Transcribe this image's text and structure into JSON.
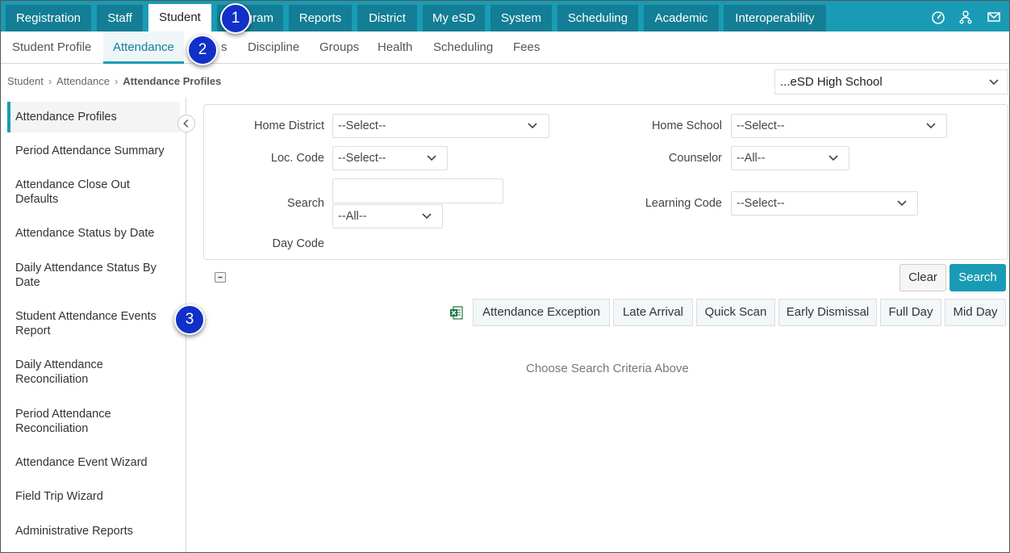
{
  "topnav": {
    "tabs": [
      "Registration",
      "Staff",
      "Student",
      "gram",
      "Reports",
      "District",
      "My eSD",
      "System",
      "Scheduling",
      "Academic",
      "Interoperability"
    ],
    "icons": [
      "dashboard-icon",
      "user-network-icon",
      "mail-icon"
    ]
  },
  "subnav": {
    "tabs": [
      "Student Profile",
      "Attendance",
      "s",
      "Discipline",
      "Groups",
      "Health",
      "Scheduling",
      "Fees"
    ]
  },
  "breadcrumb": {
    "items": [
      "Student",
      "Attendance",
      "Attendance Profiles"
    ]
  },
  "school_select": {
    "value": "...eSD High School"
  },
  "sidebar": {
    "items": [
      "Attendance Profiles",
      "Period Attendance Summary",
      "Attendance Close Out Defaults",
      "Attendance Status by Date",
      "Daily Attendance Status By Date",
      "Student Attendance Events Report",
      "Daily Attendance Reconciliation",
      "Period Attendance Reconciliation",
      "Attendance Event Wizard",
      "Field Trip Wizard",
      "Administrative Reports"
    ]
  },
  "filters": {
    "home_district": {
      "label": "Home District",
      "value": "--Select--"
    },
    "home_school": {
      "label": "Home School",
      "value": "--Select--"
    },
    "loc_code": {
      "label": "Loc. Code",
      "value": "--Select--"
    },
    "counselor": {
      "label": "Counselor",
      "value": "--All--"
    },
    "search": {
      "label": "Search",
      "value": "",
      "mode": "--All--"
    },
    "learning_code": {
      "label": "Learning Code",
      "value": "--Select--"
    },
    "day_code": {
      "label": "Day Code"
    }
  },
  "actions": {
    "clear": "Clear",
    "search": "Search"
  },
  "filter_buttons": [
    "Attendance Exception",
    "Late Arrival",
    "Quick Scan",
    "Early Dismissal",
    "Full Day",
    "Mid Day"
  ],
  "empty_message": "Choose Search Criteria Above",
  "callouts": [
    "1",
    "2",
    "3"
  ],
  "colors": {
    "brand": "#1a9bb5",
    "brand_dark": "#137e95",
    "callout": "#1030c8"
  }
}
